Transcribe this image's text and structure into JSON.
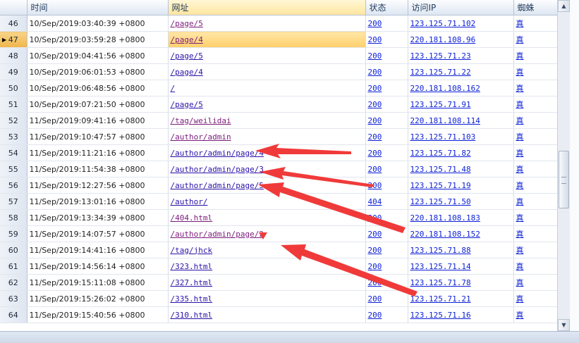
{
  "columns": {
    "rownum": "",
    "time": "时间",
    "url": "网址",
    "status": "状态",
    "ip": "访问IP",
    "spider": "蜘蛛"
  },
  "rows": [
    {
      "n": "46",
      "time": "10/Sep/2019:03:40:39 +0800",
      "url": "/page/5",
      "status": "200",
      "ip": "123.125.71.102",
      "spider": "真"
    },
    {
      "n": "47",
      "time": "10/Sep/2019:03:59:28 +0800",
      "url": "/page/4",
      "status": "200",
      "ip": "220.181.108.96",
      "spider": "真"
    },
    {
      "n": "48",
      "time": "10/Sep/2019:04:41:56 +0800",
      "url": "/page/5",
      "status": "200",
      "ip": "123.125.71.23",
      "spider": "真"
    },
    {
      "n": "49",
      "time": "10/Sep/2019:06:01:53 +0800",
      "url": "/page/4",
      "status": "200",
      "ip": "123.125.71.22",
      "spider": "真"
    },
    {
      "n": "50",
      "time": "10/Sep/2019:06:48:56 +0800",
      "url": "/",
      "status": "200",
      "ip": "220.181.108.162",
      "spider": "真"
    },
    {
      "n": "51",
      "time": "10/Sep/2019:07:21:50 +0800",
      "url": "/page/5",
      "status": "200",
      "ip": "123.125.71.91",
      "spider": "真"
    },
    {
      "n": "52",
      "time": "11/Sep/2019:09:41:16 +0800",
      "url": "/tag/weilidai",
      "status": "200",
      "ip": "220.181.108.114",
      "spider": "真"
    },
    {
      "n": "53",
      "time": "11/Sep/2019:10:47:57 +0800",
      "url": "/author/admin",
      "status": "200",
      "ip": "123.125.71.103",
      "spider": "真"
    },
    {
      "n": "54",
      "time": "11/Sep/2019:11:21:16 +0800",
      "url": "/author/admin/page/4",
      "status": "200",
      "ip": "123.125.71.82",
      "spider": "真"
    },
    {
      "n": "55",
      "time": "11/Sep/2019:11:54:38 +0800",
      "url": "/author/admin/page/3",
      "status": "200",
      "ip": "123.125.71.48",
      "spider": "真"
    },
    {
      "n": "56",
      "time": "11/Sep/2019:12:27:56 +0800",
      "url": "/author/admin/page/5",
      "status": "200",
      "ip": "123.125.71.19",
      "spider": "真"
    },
    {
      "n": "57",
      "time": "11/Sep/2019:13:01:16 +0800",
      "url": "/author/",
      "status": "404",
      "ip": "123.125.71.50",
      "spider": "真"
    },
    {
      "n": "58",
      "time": "11/Sep/2019:13:34:39 +0800",
      "url": "/404.html",
      "status": "200",
      "ip": "220.181.108.183",
      "spider": "真"
    },
    {
      "n": "59",
      "time": "11/Sep/2019:14:07:57 +0800",
      "url": "/author/admin/page/2",
      "status": "200",
      "ip": "220.181.108.152",
      "spider": "真"
    },
    {
      "n": "60",
      "time": "11/Sep/2019:14:41:16 +0800",
      "url": "/tag/jhck",
      "status": "200",
      "ip": "123.125.71.88",
      "spider": "真"
    },
    {
      "n": "61",
      "time": "11/Sep/2019:14:56:14 +0800",
      "url": "/323.html",
      "status": "200",
      "ip": "123.125.71.14",
      "spider": "真"
    },
    {
      "n": "62",
      "time": "11/Sep/2019:15:11:08 +0800",
      "url": "/327.html",
      "status": "200",
      "ip": "123.125.71.78",
      "spider": "真"
    },
    {
      "n": "63",
      "time": "11/Sep/2019:15:26:02 +0800",
      "url": "/335.html",
      "status": "200",
      "ip": "123.125.71.21",
      "spider": "真"
    },
    {
      "n": "64",
      "time": "11/Sep/2019:15:40:56 +0800",
      "url": "/310.html",
      "status": "200",
      "ip": "123.125.71.16",
      "spider": "真"
    }
  ],
  "selected_row": "47",
  "colors": {
    "link": "#0b1fd6",
    "visited": "#7b1c7b",
    "selection": "#ffcf6a",
    "annotation_arrow": "#f03a3a"
  }
}
